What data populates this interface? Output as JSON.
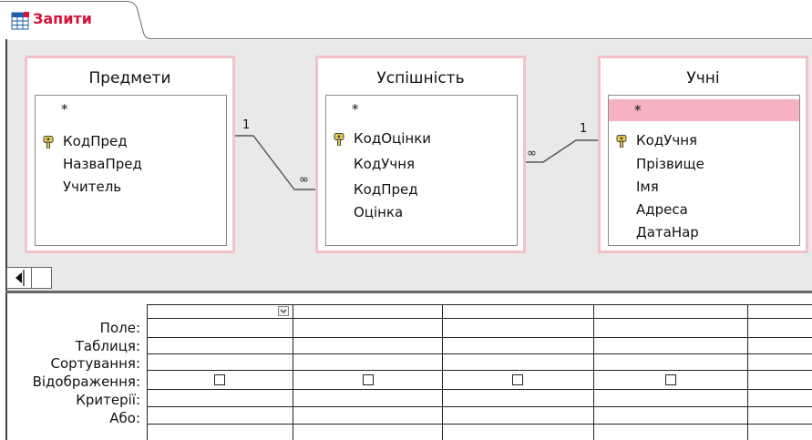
{
  "tab": {
    "title": "Запити",
    "accent_color": "#d4163c",
    "icon": "query-grid-icon"
  },
  "tables": [
    {
      "title": "Предмети",
      "fields": [
        "*",
        "КодПред",
        "НазваПред",
        "Учитель"
      ],
      "key_field": "КодПред"
    },
    {
      "title": "Успішність",
      "fields": [
        "*",
        "КодОцінки",
        "КодУчня",
        "КодПред",
        "Оцінка"
      ],
      "key_field": "КодОцінки"
    },
    {
      "title": "Учні",
      "fields": [
        "*",
        "КодУчня",
        "Прізвище",
        "Імя",
        "Адреса",
        "ДатаНар"
      ],
      "key_field": "КодУчня",
      "selected_field": "*"
    }
  ],
  "relations": [
    {
      "from": "Предмети",
      "to": "Успішність",
      "one_label": "1",
      "many_label": "∞"
    },
    {
      "from": "Учні",
      "to": "Успішність",
      "one_label": "1",
      "many_label": "∞"
    }
  ],
  "grid": {
    "row_labels": [
      "Поле:",
      "Таблиця:",
      "Сортування:",
      "Відображення:",
      "Критерії:",
      "Або:"
    ]
  },
  "colors": {
    "table_border": "#f2c2cb",
    "selected_row": "#f7b2c0",
    "design_bg": "#e9e9e9"
  }
}
